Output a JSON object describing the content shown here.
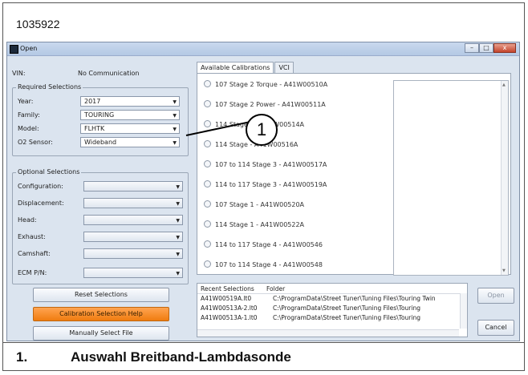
{
  "doc_id": "1035922",
  "window": {
    "title": "Open",
    "min": "–",
    "max": "□",
    "close": "x"
  },
  "vin": {
    "label": "VIN:",
    "value": "No Communication"
  },
  "required": {
    "legend": "Required Selections",
    "rows": [
      {
        "label": "Year:",
        "value": "2017"
      },
      {
        "label": "Family:",
        "value": "TOURING"
      },
      {
        "label": "Model:",
        "value": "FLHTK"
      },
      {
        "label": "O2 Sensor:",
        "value": "Wideband"
      }
    ]
  },
  "optional": {
    "legend": "Optional Selections",
    "rows": [
      {
        "label": "Configuration:",
        "value": ""
      },
      {
        "label": "Displacement:",
        "value": ""
      },
      {
        "label": "Head:",
        "value": ""
      },
      {
        "label": "Exhaust:",
        "value": ""
      },
      {
        "label": "Camshaft:",
        "value": ""
      },
      {
        "label": "ECM P/N:",
        "value": ""
      }
    ]
  },
  "buttons": {
    "reset": "Reset Selections",
    "help": "Calibration Selection Help",
    "manual": "Manually Select File",
    "open": "Open",
    "cancel": "Cancel"
  },
  "tabs": {
    "calibrations": "Available Calibrations",
    "vci": "VCI"
  },
  "calibrations": [
    "107 Stage 2 Torque - A41W00510A",
    "107 Stage 2 Power - A41W00511A",
    "114 Stage 2 - A41W00514A",
    "114 Stage - A41W00516A",
    "107 to 114 Stage 3 - A41W00517A",
    "114 to 117 Stage 3 - A41W00519A",
    "107 Stage 1 - A41W00520A",
    "114 Stage 1 - A41W00522A",
    "114 to 117 Stage 4 - A41W00546",
    "107 to 114 Stage 4 - A41W00548"
  ],
  "recent": {
    "header_selections": "Recent Selections",
    "header_folder": "Folder",
    "rows": [
      {
        "file": "A41W00519A.lt0",
        "folder": "C:\\ProgramData\\Street Tuner\\Tuning Files\\Touring Twin"
      },
      {
        "file": "A41W00513A-2.lt0",
        "folder": "C:\\ProgramData\\Street Tuner\\Tuning Files\\Touring"
      },
      {
        "file": "A41W00513A-1.lt0",
        "folder": "C:\\ProgramData\\Street Tuner\\Tuning Files\\Touring"
      }
    ]
  },
  "callout": {
    "number": "1"
  },
  "caption": {
    "number": "1.",
    "text": "Auswahl Breitband-Lambdasonde"
  }
}
